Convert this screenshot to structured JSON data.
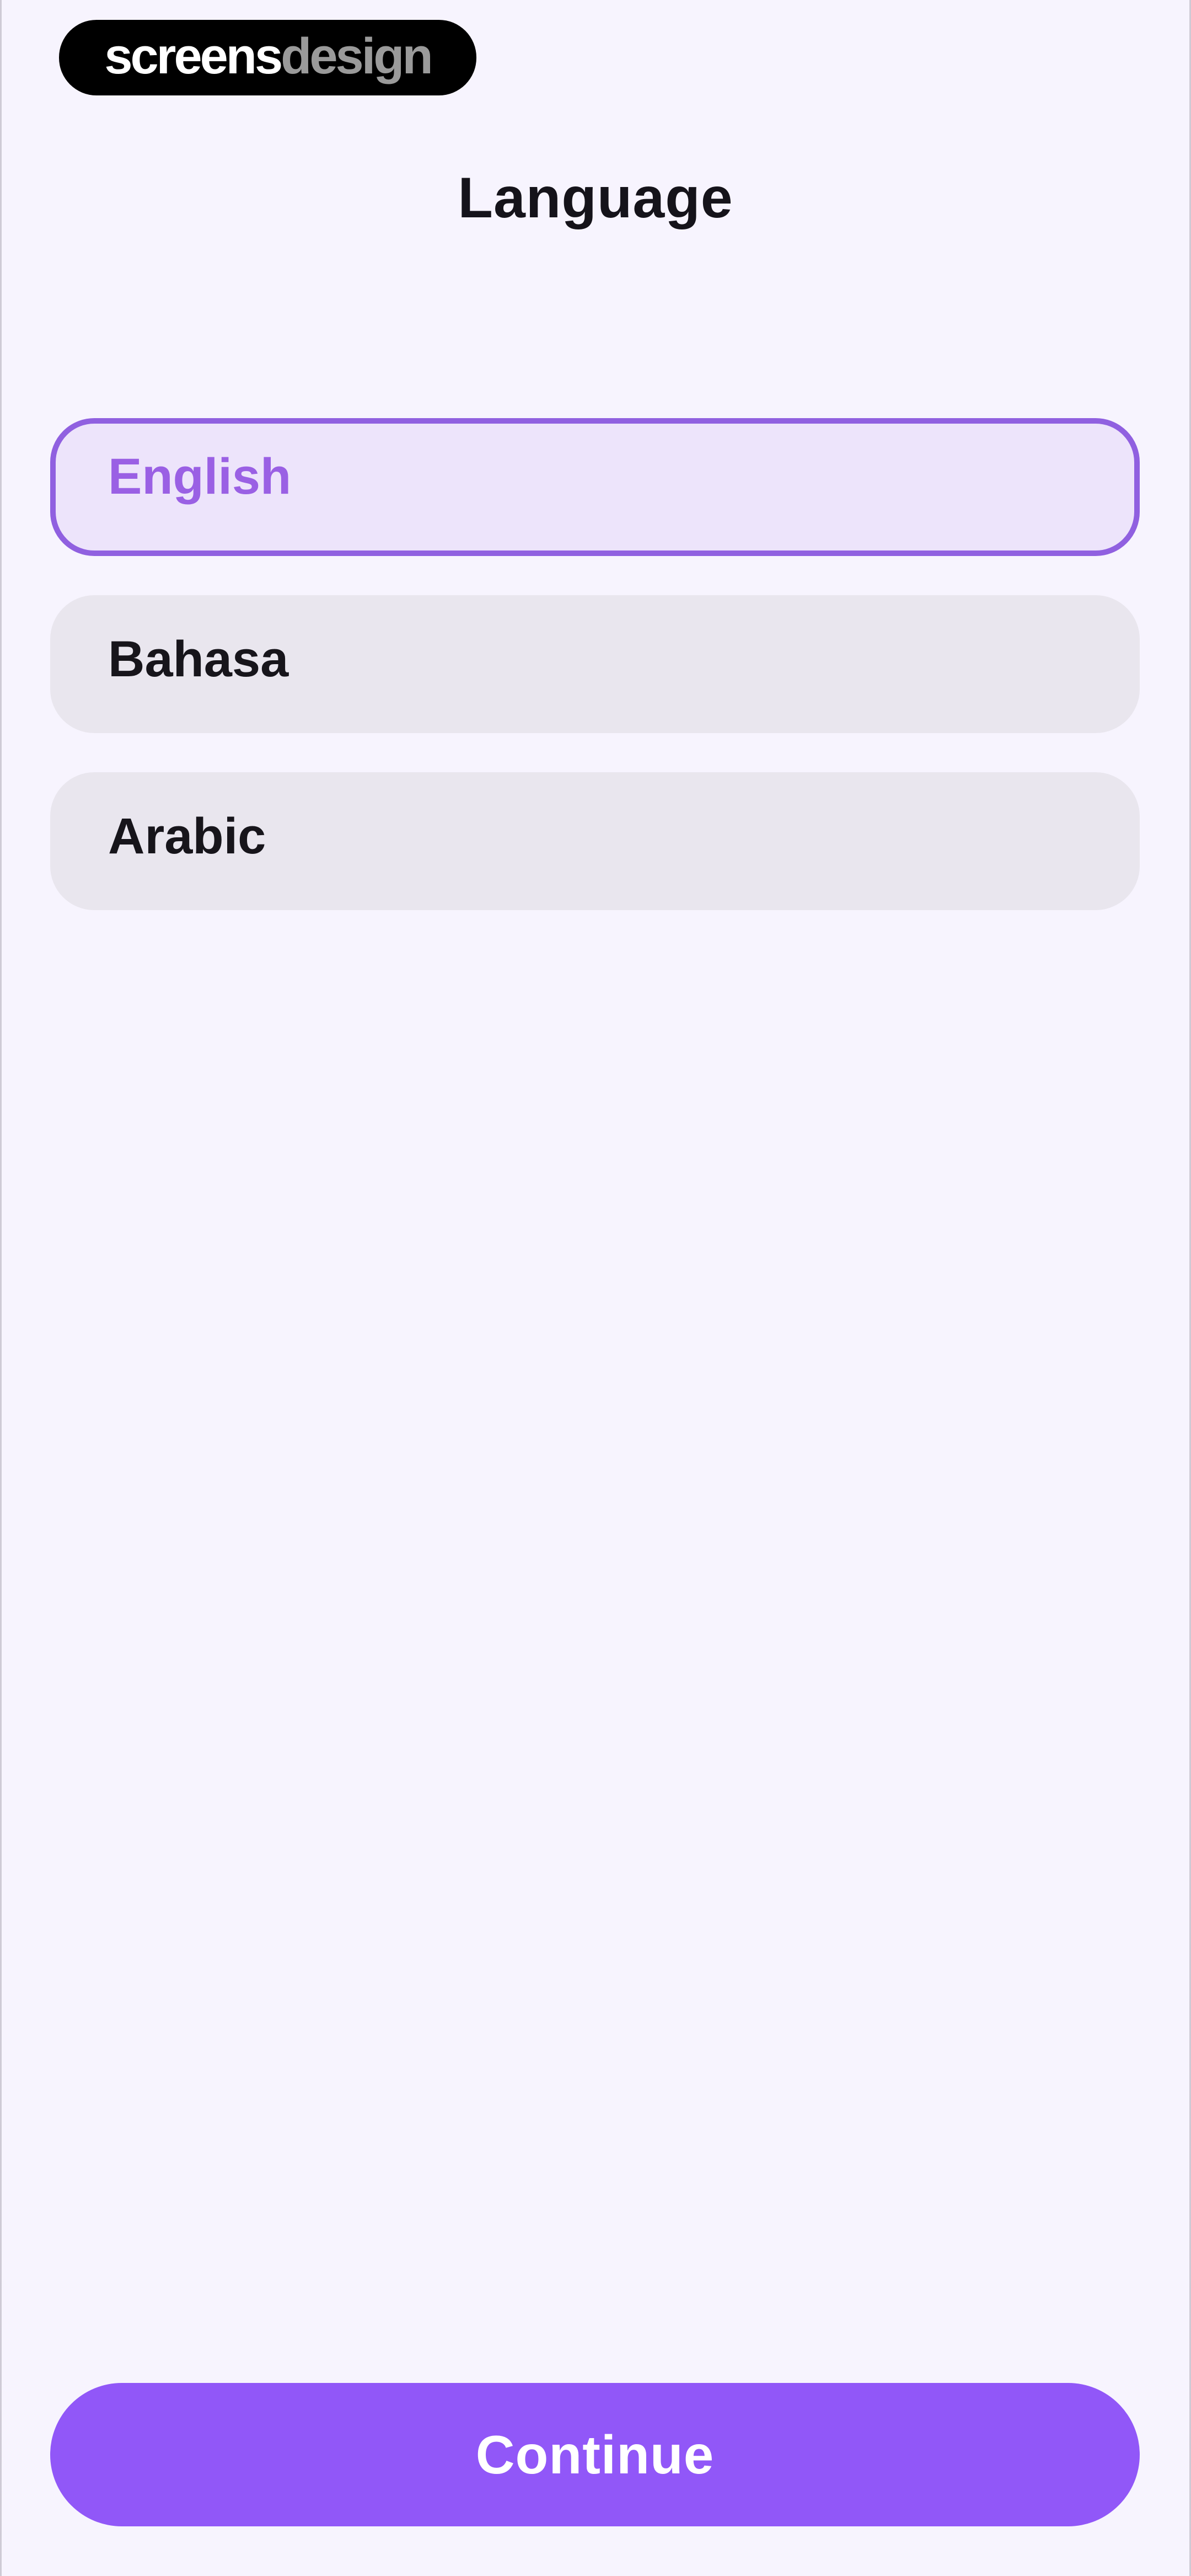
{
  "brand": {
    "part1": "screens",
    "part2": "design"
  },
  "header": {
    "title": "Language"
  },
  "languages": [
    {
      "label": "English",
      "selected": true
    },
    {
      "label": "Bahasa",
      "selected": false
    },
    {
      "label": "Arabic",
      "selected": false
    }
  ],
  "footer": {
    "continue_label": "Continue"
  },
  "colors": {
    "background": "#f7f4fe",
    "accent": "#9157f8",
    "selected_border": "#9060e0",
    "selected_fill": "#ede4fb",
    "option_fill": "#e9e6ee"
  }
}
